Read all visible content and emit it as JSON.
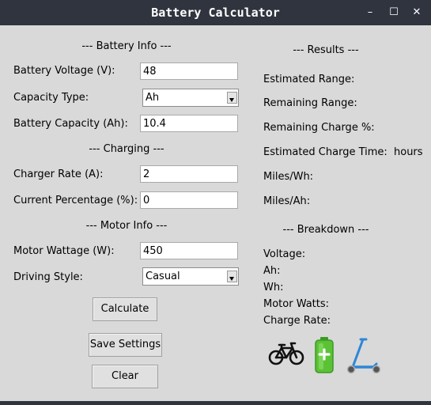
{
  "window": {
    "title": "Battery Calculator",
    "controls": {
      "minimize": "–",
      "maximize": "☐",
      "close": "✕"
    }
  },
  "battery_info": {
    "header": "--- Battery Info ---",
    "voltage_label": "Battery Voltage (V):",
    "voltage_value": "48",
    "capacity_type_label": "Capacity Type:",
    "capacity_type_value": "Ah",
    "capacity_label": "Battery Capacity (Ah):",
    "capacity_value": "10.4"
  },
  "charging": {
    "header": "--- Charging ---",
    "rate_label": "Charger Rate (A):",
    "rate_value": "2",
    "percentage_label": "Current Percentage (%):",
    "percentage_value": "0"
  },
  "motor_info": {
    "header": "--- Motor Info ---",
    "wattage_label": "Motor Wattage (W):",
    "wattage_value": "450",
    "style_label": "Driving Style:",
    "style_value": "Casual"
  },
  "buttons": {
    "calculate": "Calculate",
    "save": "Save Settings",
    "clear": "Clear"
  },
  "results": {
    "header": "--- Results ---",
    "estimated_range": "Estimated Range:",
    "remaining_range": "Remaining Range:",
    "remaining_charge": "Remaining Charge %:",
    "charge_time": "Estimated Charge Time:",
    "charge_time_unit": "hours",
    "miles_per_wh": "Miles/Wh:",
    "miles_per_ah": "Miles/Ah:"
  },
  "breakdown": {
    "header": "--- Breakdown ---",
    "voltage": "Voltage:",
    "ah": "Ah:",
    "wh": "Wh:",
    "motor_watts": "Motor Watts:",
    "charge_rate": "Charge Rate:"
  },
  "icons": [
    "bicycle-icon",
    "battery-icon",
    "kick-scooter-icon"
  ],
  "colors": {
    "titlebar": "#2f343f",
    "window_bg": "#d9d9d9",
    "battery_green": "#5bc236",
    "scooter_blue": "#2f86d6"
  }
}
